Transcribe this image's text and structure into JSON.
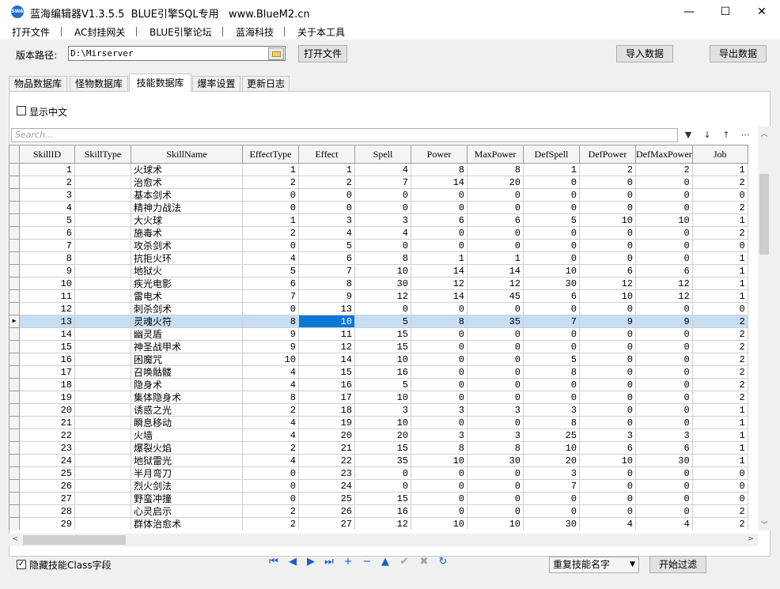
{
  "window": {
    "app_icon_text": "SWA",
    "title": "蓝海编辑器V1.3.5.5  BLUE引擎SQL专用   www.BlueM2.cn",
    "minimize": "—",
    "maximize": "☐",
    "close": "✕"
  },
  "menu": [
    "打开文件",
    "AC封挂网关",
    "BLUE引擎论坛",
    "蓝海科技",
    "关于本工具"
  ],
  "path": {
    "label": "版本路径:",
    "value": "D:\\Mirserver",
    "open_button": "打开文件",
    "import_button": "导入数据",
    "export_button": "导出数据"
  },
  "tabs": [
    "物品数据库",
    "怪物数据库",
    "技能数据库",
    "爆率设置",
    "更新日志"
  ],
  "active_tab": "技能数据库",
  "show_chinese_label": "显示中文",
  "show_chinese_checked": false,
  "search_placeholder": "Search...",
  "toolbar_icons": {
    "filter": "▼",
    "sort_down": "↓",
    "sort_up": "↑",
    "more": "⋯"
  },
  "grid": {
    "columns": [
      "SkillID",
      "SkillType",
      "SkillName",
      "EffectType",
      "Effect",
      "Spell",
      "Power",
      "MaxPower",
      "DefSpell",
      "DefPower",
      "DefMaxPower",
      "Job"
    ],
    "rows": [
      [
        "1",
        "",
        "火球术",
        "1",
        "1",
        "4",
        "8",
        "8",
        "1",
        "2",
        "2",
        "1"
      ],
      [
        "2",
        "",
        "治愈术",
        "2",
        "2",
        "7",
        "14",
        "20",
        "0",
        "0",
        "0",
        "2"
      ],
      [
        "3",
        "",
        "基本剑术",
        "0",
        "0",
        "0",
        "0",
        "0",
        "0",
        "0",
        "0",
        "0"
      ],
      [
        "4",
        "",
        "精神力战法",
        "0",
        "0",
        "0",
        "0",
        "0",
        "0",
        "0",
        "0",
        "2"
      ],
      [
        "5",
        "",
        "大火球",
        "1",
        "3",
        "3",
        "6",
        "6",
        "5",
        "10",
        "10",
        "1"
      ],
      [
        "6",
        "",
        "施毒术",
        "2",
        "4",
        "4",
        "0",
        "0",
        "0",
        "0",
        "0",
        "2"
      ],
      [
        "7",
        "",
        "攻杀剑术",
        "0",
        "5",
        "0",
        "0",
        "0",
        "0",
        "0",
        "0",
        "0"
      ],
      [
        "8",
        "",
        "抗拒火环",
        "4",
        "6",
        "8",
        "1",
        "1",
        "0",
        "0",
        "0",
        "1"
      ],
      [
        "9",
        "",
        "地狱火",
        "5",
        "7",
        "10",
        "14",
        "14",
        "10",
        "6",
        "6",
        "1"
      ],
      [
        "10",
        "",
        "疾光电影",
        "6",
        "8",
        "30",
        "12",
        "12",
        "30",
        "12",
        "12",
        "1"
      ],
      [
        "11",
        "",
        "雷电术",
        "7",
        "9",
        "12",
        "14",
        "45",
        "6",
        "10",
        "12",
        "1"
      ],
      [
        "12",
        "",
        "刺杀剑术",
        "0",
        "13",
        "0",
        "0",
        "0",
        "0",
        "0",
        "0",
        "0"
      ],
      [
        "13",
        "",
        "灵魂火符",
        "8",
        "10",
        "5",
        "8",
        "35",
        "7",
        "9",
        "9",
        "2"
      ],
      [
        "14",
        "",
        "幽灵盾",
        "9",
        "11",
        "15",
        "0",
        "0",
        "0",
        "0",
        "0",
        "2"
      ],
      [
        "15",
        "",
        "神圣战甲术",
        "9",
        "12",
        "15",
        "0",
        "0",
        "0",
        "0",
        "0",
        "2"
      ],
      [
        "16",
        "",
        "困魔咒",
        "10",
        "14",
        "10",
        "0",
        "0",
        "5",
        "0",
        "0",
        "2"
      ],
      [
        "17",
        "",
        "召唤骷髅",
        "4",
        "15",
        "16",
        "0",
        "0",
        "8",
        "0",
        "0",
        "2"
      ],
      [
        "18",
        "",
        "隐身术",
        "4",
        "16",
        "5",
        "0",
        "0",
        "0",
        "0",
        "0",
        "2"
      ],
      [
        "19",
        "",
        "集体隐身术",
        "8",
        "17",
        "10",
        "0",
        "0",
        "0",
        "0",
        "0",
        "2"
      ],
      [
        "20",
        "",
        "诱惑之光",
        "2",
        "18",
        "3",
        "3",
        "3",
        "3",
        "0",
        "0",
        "1"
      ],
      [
        "21",
        "",
        "瞬息移动",
        "4",
        "19",
        "10",
        "0",
        "0",
        "8",
        "0",
        "0",
        "1"
      ],
      [
        "22",
        "",
        "火墙",
        "4",
        "20",
        "20",
        "3",
        "3",
        "25",
        "3",
        "3",
        "1"
      ],
      [
        "23",
        "",
        "爆裂火焰",
        "2",
        "21",
        "15",
        "8",
        "8",
        "10",
        "6",
        "6",
        "1"
      ],
      [
        "24",
        "",
        "地狱雷光",
        "4",
        "22",
        "35",
        "10",
        "30",
        "20",
        "10",
        "30",
        "1"
      ],
      [
        "25",
        "",
        "半月弯刀",
        "0",
        "23",
        "0",
        "0",
        "0",
        "3",
        "0",
        "0",
        "0"
      ],
      [
        "26",
        "",
        "烈火剑法",
        "0",
        "24",
        "0",
        "0",
        "0",
        "7",
        "0",
        "0",
        "0"
      ],
      [
        "27",
        "",
        "野蛮冲撞",
        "0",
        "25",
        "15",
        "0",
        "0",
        "0",
        "0",
        "0",
        "0"
      ],
      [
        "28",
        "",
        "心灵启示",
        "2",
        "26",
        "16",
        "0",
        "0",
        "0",
        "0",
        "0",
        "2"
      ],
      [
        "29",
        "",
        "群体治愈术",
        "2",
        "27",
        "12",
        "10",
        "10",
        "30",
        "4",
        "4",
        "2"
      ]
    ],
    "selected_row": 13,
    "row_indicator": "▶"
  },
  "scroll_arrows": {
    "up": "︿",
    "down": "﹀",
    "left": "<",
    "right": ">"
  },
  "footer": {
    "hide_class_label": "隐藏技能Class字段",
    "hide_class_checked": true,
    "nav": [
      {
        "name": "first-record-icon",
        "glyph": "⏮",
        "enabled": true
      },
      {
        "name": "prior-record-icon",
        "glyph": "◀",
        "enabled": true
      },
      {
        "name": "next-record-icon",
        "glyph": "▶",
        "enabled": true
      },
      {
        "name": "last-record-icon",
        "glyph": "⏭",
        "enabled": true
      },
      {
        "name": "insert-record-icon",
        "glyph": "+",
        "enabled": true
      },
      {
        "name": "delete-record-icon",
        "glyph": "−",
        "enabled": true
      },
      {
        "name": "edit-record-icon",
        "glyph": "▲",
        "enabled": true
      },
      {
        "name": "post-record-icon",
        "glyph": "✔",
        "enabled": false
      },
      {
        "name": "cancel-record-icon",
        "glyph": "✖",
        "enabled": false
      },
      {
        "name": "refresh-record-icon",
        "glyph": "↻",
        "enabled": true
      }
    ],
    "filter_select": "重复技能名字",
    "filter_button": "开始过滤"
  },
  "colors": {
    "selected_row": "#c6def3",
    "active_cell": "#0a78d7",
    "nav_icon": "#1a5fc7"
  }
}
